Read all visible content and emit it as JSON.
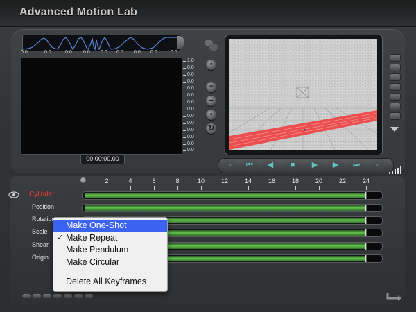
{
  "app": {
    "title": "Advanced Motion Lab"
  },
  "curve_strip": {
    "labels": [
      "0.0",
      "0.0",
      "0.0",
      "0.0",
      "0.0",
      "0.0",
      "0.0",
      "0.0",
      "0.0"
    ]
  },
  "graph": {
    "scale_labels": [
      "1.0",
      "0.0",
      "0.0",
      "0.0",
      "0.0",
      "0.0",
      "0.0",
      "0.0",
      "0.0",
      "0.0",
      "0.0",
      "0.0",
      "0.0",
      "0.0"
    ]
  },
  "timecode": "00:00:00.00",
  "timeline": {
    "ruler_labels": [
      "2",
      "4",
      "6",
      "8",
      "10",
      "12",
      "14",
      "16",
      "18",
      "20",
      "22",
      "24"
    ],
    "tracks": [
      {
        "label": "Cylinder ...",
        "color": "#ff3a3a"
      },
      {
        "label": "Position"
      },
      {
        "label": "Rotation"
      },
      {
        "label": "Scale"
      },
      {
        "label": "Shear"
      },
      {
        "label": "Origin"
      }
    ]
  },
  "context_menu": {
    "items": [
      {
        "label": "Make One-Shot",
        "highlighted": true,
        "checked": false
      },
      {
        "label": "Make Repeat",
        "highlighted": false,
        "checked": true,
        "check_glyph": "✓"
      },
      {
        "label": "Make Pendulum",
        "highlighted": false,
        "checked": false
      },
      {
        "label": "Make Circular",
        "highlighted": false,
        "checked": false
      },
      {
        "label": "Delete All Keyframes",
        "highlighted": false,
        "checked": false
      }
    ]
  },
  "colors": {
    "accent_red": "#ff3a3a",
    "track_green": "#63c24d",
    "menu_highlight": "#3b63f2",
    "viewport_floor_band": "#ee4444"
  },
  "icons": {
    "transport": [
      "stop-icon",
      "go-to-start-icon",
      "step-back-icon",
      "stop-square-icon",
      "play-icon",
      "step-forward-icon",
      "go-to-end-icon",
      "loop-icon"
    ],
    "view_controls": [
      "zoom-in-icon",
      "zoom-out-icon",
      "fit-view-icon",
      "reset-view-icon"
    ]
  }
}
